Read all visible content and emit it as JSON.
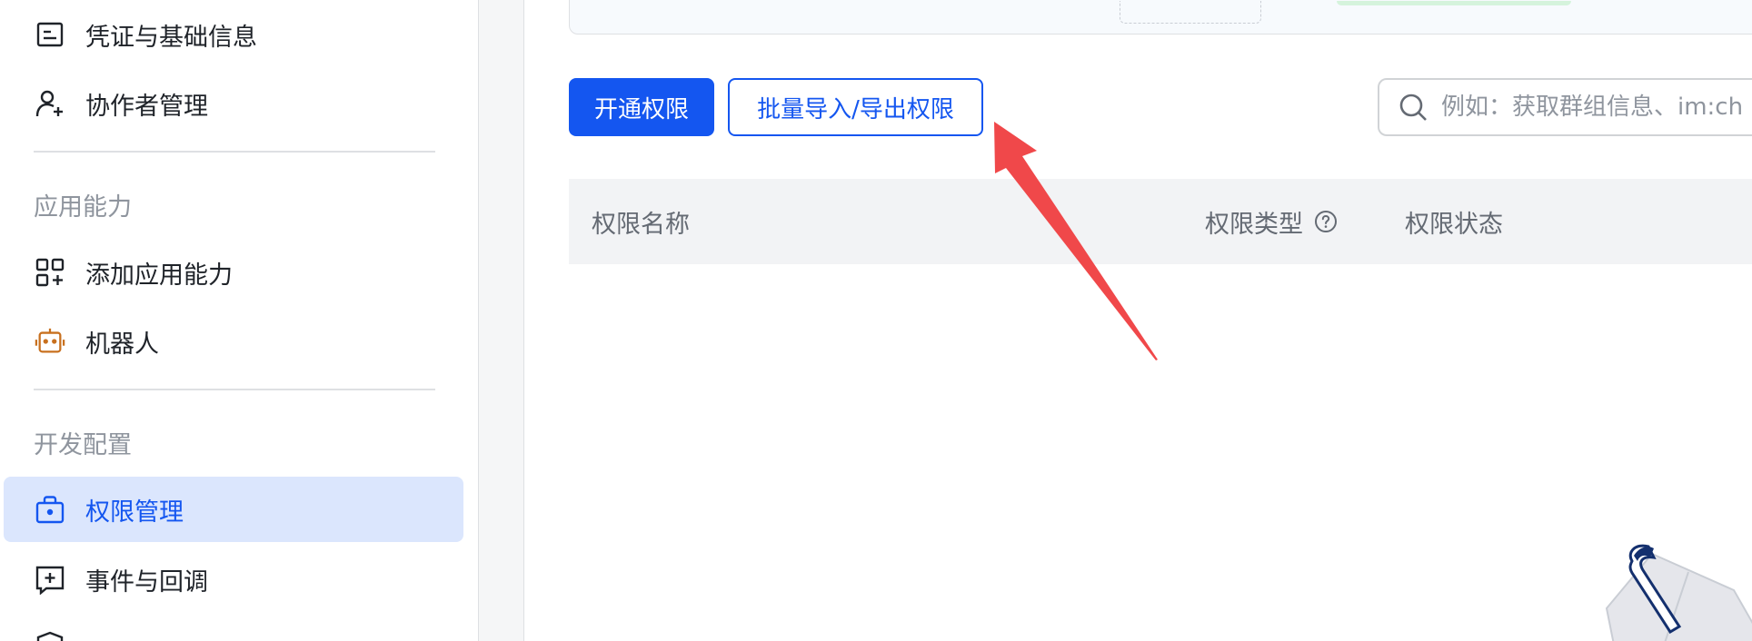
{
  "sidebar": {
    "items": [
      {
        "label": "凭证与基础信息",
        "icon": "credential-card-icon"
      },
      {
        "label": "协作者管理",
        "icon": "user-add-icon"
      },
      {
        "label": "添加应用能力",
        "icon": "app-grid-add-icon"
      },
      {
        "label": "机器人",
        "icon": "robot-icon"
      },
      {
        "label": "权限管理",
        "icon": "permission-bag-icon",
        "active": true
      },
      {
        "label": "事件与回调",
        "icon": "event-add-icon"
      }
    ],
    "groups": {
      "app_capability": "应用能力",
      "dev_config": "开发配置"
    }
  },
  "toolbar": {
    "enable_permission_label": "开通权限",
    "bulk_import_export_label": "批量导入/导出权限"
  },
  "search": {
    "placeholder": "例如：获取群组信息、im:ch"
  },
  "table": {
    "columns": [
      "权限名称",
      "权限类型",
      "权限状态"
    ]
  },
  "colors": {
    "accent": "#1456f0",
    "active_bg": "#dbe6fd",
    "arrow": "#f0484a"
  }
}
